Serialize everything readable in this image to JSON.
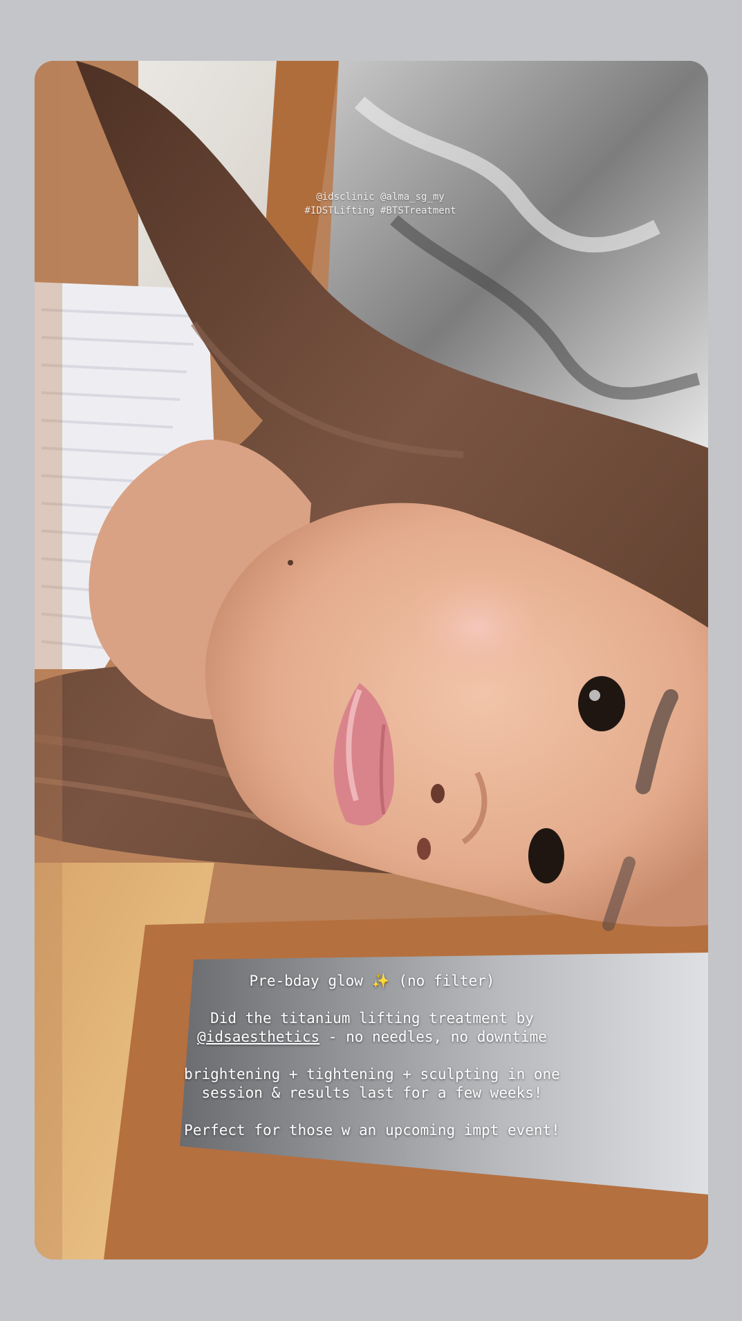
{
  "story": {
    "photo_description_icon": "selfie-photo",
    "tag_lines": [
      "@idsclinic @alma_sg_my",
      "#IDSTLifting #BTSTreatment"
    ],
    "caption": {
      "line1_text": "Pre-bday glow",
      "line1_emoji": "✨",
      "line1_suffix": "(no filter)",
      "line2_a": "Did the titanium lifting treatment by",
      "line2_mention": "@idsaesthetics",
      "line2_b": " - no needles, no downtime",
      "line3_a": "brightening + tightening + sculpting in one",
      "line3_b": "session & results last for a few weeks!",
      "line4": "Perfect for those w an upcoming impt event!"
    }
  },
  "colors": {
    "frame_background": "#c4c5c9",
    "wood": "#b9825a",
    "hair": "#5a3b2a",
    "skin": "#e9b89a",
    "top": "#eeeef2"
  }
}
